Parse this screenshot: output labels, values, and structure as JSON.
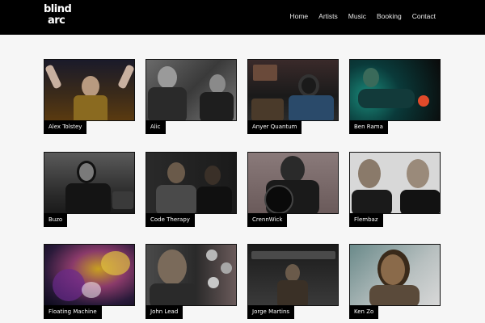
{
  "header": {
    "logo_line1": "blind",
    "logo_line2": "arc",
    "nav": [
      "Home",
      "Artists",
      "Music",
      "Booking",
      "Contact"
    ]
  },
  "artists": [
    {
      "name": "Alex Tolstey"
    },
    {
      "name": "Alic"
    },
    {
      "name": "Anyer Quantum"
    },
    {
      "name": "Ben Rama"
    },
    {
      "name": "Buzo"
    },
    {
      "name": "Code Therapy"
    },
    {
      "name": "CrennWick"
    },
    {
      "name": "Flembaz"
    },
    {
      "name": "Floating Machine"
    },
    {
      "name": "John Lead"
    },
    {
      "name": "Jorge Martins"
    },
    {
      "name": "Ken Zo"
    }
  ],
  "colors": {
    "header_bg": "#000000",
    "page_bg": "#f6f6f6",
    "label_bg": "#000000"
  }
}
